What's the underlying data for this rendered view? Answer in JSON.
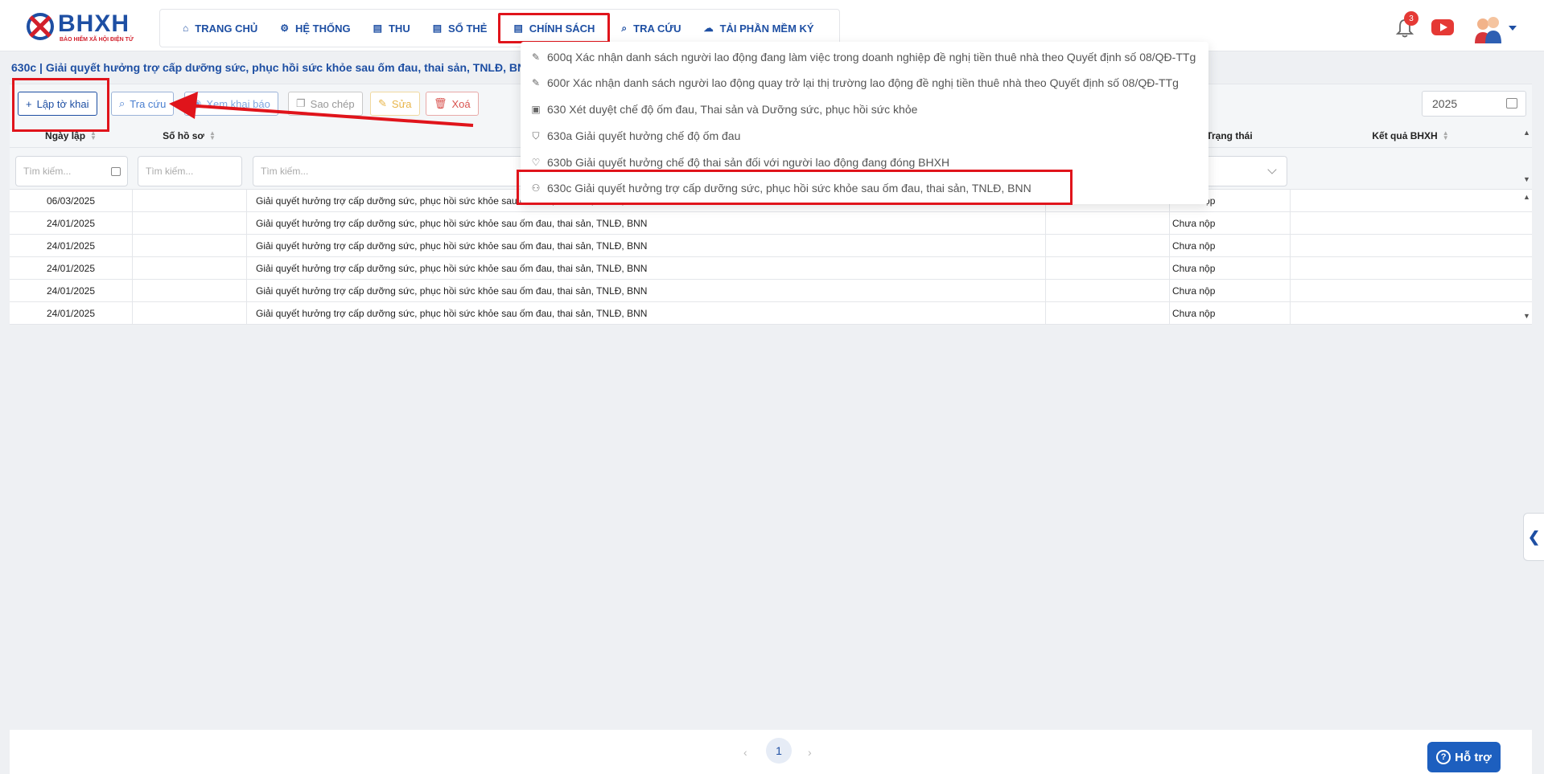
{
  "logo": {
    "text": "BHXH",
    "subtitle": "BẢO HIỂM XÃ HỘI ĐIỆN TỬ"
  },
  "nav": [
    {
      "label": "TRANG CHỦ",
      "icon": "home-icon"
    },
    {
      "label": "HỆ THỐNG",
      "icon": "gear-icon"
    },
    {
      "label": "THU",
      "icon": "document-icon"
    },
    {
      "label": "SỔ THẺ",
      "icon": "document-icon"
    },
    {
      "label": "CHÍNH SÁCH",
      "icon": "document-icon",
      "active": true
    },
    {
      "label": "TRA CỨU",
      "icon": "search-icon"
    },
    {
      "label": "TẢI PHẦN MỀM KÝ",
      "icon": "cloud-download-icon"
    }
  ],
  "header": {
    "notification_count": "3"
  },
  "page_title": "630c | Giải quyết hưởng trợ cấp dưỡng sức, phục hồi sức khỏe sau ốm đau, thai sản, TNLĐ, BNN",
  "toolbar": {
    "create": "Lập tờ khai",
    "search": "Tra cứu",
    "view": "Xem khai báo",
    "copy": "Sao chép",
    "edit": "Sửa",
    "delete": "Xoá",
    "year": "2025"
  },
  "table": {
    "headers": {
      "date": "Ngày lập",
      "file_no": "Số hồ sơ",
      "status": "Trạng thái",
      "result": "Kết quả BHXH"
    },
    "search_placeholder": "Tìm kiếm...",
    "rows": [
      {
        "date": "06/03/2025",
        "name": "Giải quyết hưởng trợ cấp dưỡng sức, phục hồi sức khỏe sau ốm đau, thai sản, TNLĐ, BNN",
        "status": "Chưa nộp"
      },
      {
        "date": "24/01/2025",
        "name": "Giải quyết hưởng trợ cấp dưỡng sức, phục hồi sức khỏe sau ốm đau, thai sản, TNLĐ, BNN",
        "status": "Chưa nộp"
      },
      {
        "date": "24/01/2025",
        "name": "Giải quyết hưởng trợ cấp dưỡng sức, phục hồi sức khỏe sau ốm đau, thai sản, TNLĐ, BNN",
        "status": "Chưa nộp"
      },
      {
        "date": "24/01/2025",
        "name": "Giải quyết hưởng trợ cấp dưỡng sức, phục hồi sức khỏe sau ốm đau, thai sản, TNLĐ, BNN",
        "status": "Chưa nộp"
      },
      {
        "date": "24/01/2025",
        "name": "Giải quyết hưởng trợ cấp dưỡng sức, phục hồi sức khỏe sau ốm đau, thai sản, TNLĐ, BNN",
        "status": "Chưa nộp"
      },
      {
        "date": "24/01/2025",
        "name": "Giải quyết hưởng trợ cấp dưỡng sức, phục hồi sức khỏe sau ốm đau, thai sản, TNLĐ, BNN",
        "status": "Chưa nộp"
      }
    ]
  },
  "dropdown": [
    {
      "label": "600q Xác nhận danh sách người lao động đang làm việc trong doanh nghiệp đề nghị tiền thuê nhà theo Quyết định số 08/QĐ-TTg",
      "icon": "edit-icon"
    },
    {
      "label": "600r Xác nhận danh sách người lao động quay trở lại thị trường lao động đề nghị tiền thuê nhà theo Quyết định số 08/QĐ-TTg",
      "icon": "edit-icon"
    },
    {
      "label": "630 Xét duyệt chế độ ốm đau, Thai sản và Dưỡng sức, phục hồi sức khỏe",
      "icon": "clipboard-icon"
    },
    {
      "label": "630a Giải quyết hưởng chế độ ốm đau",
      "icon": "shield-check-icon"
    },
    {
      "label": "630b Giải quyết hưởng chế độ thai sản đối với người lao động đang đóng BHXH",
      "icon": "heart-icon"
    },
    {
      "label": "630c Giải quyết hưởng trợ cấp dưỡng sức, phục hồi sức khỏe sau ốm đau, thai sản, TNLĐ, BNN",
      "icon": "user-icon",
      "highlighted": true
    }
  ],
  "pagination": {
    "current": "1"
  },
  "help": {
    "label": "Hỗ trợ"
  },
  "colors": {
    "brand": "#1e4fa3",
    "annotation": "#e0141b"
  }
}
